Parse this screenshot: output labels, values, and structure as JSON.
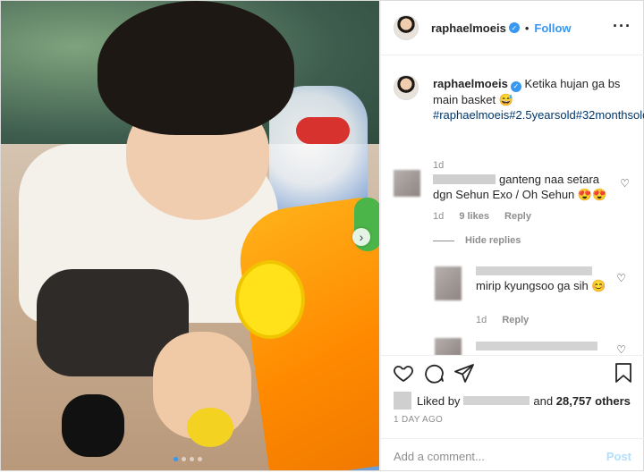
{
  "post": {
    "username": "raphaelmoeis",
    "follow_label": "Follow",
    "caption_text": "Ketika hujan ga bs main basket 😅",
    "caption_hashtags": "#raphaelmoeis#2.5yearsold#32monthsold",
    "caption_time": "1d"
  },
  "comments": [
    {
      "text": "ganteng naa setara dgn Sehun Exo / Oh Sehun 😍😍",
      "time": "1d",
      "likes": "9 likes",
      "reply_label": "Reply"
    }
  ],
  "hide_replies_label": "Hide replies",
  "replies": [
    {
      "text": "mirip kyungsoo ga sih 😊",
      "time": "1d",
      "reply_label": "Reply"
    }
  ],
  "likes": {
    "prefix": "Liked by",
    "suffix": "and",
    "count": "28,757 others"
  },
  "post_time": "1 DAY AGO",
  "add_comment": {
    "placeholder": "Add a comment...",
    "post_label": "Post"
  },
  "icons": [
    "heart-icon",
    "comment-icon",
    "share-icon",
    "bookmark-icon",
    "more-icon",
    "verified-icon",
    "next-icon"
  ],
  "carousel": {
    "total": 4,
    "active": 1
  },
  "colors": {
    "accent": "#3897f0",
    "text": "#262626",
    "muted": "#8e8e8e",
    "hashtag": "#00376b"
  }
}
